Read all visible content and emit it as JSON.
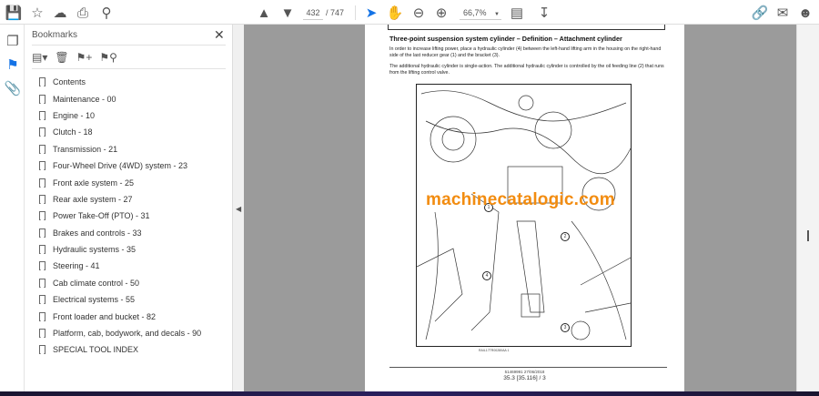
{
  "toolbar": {
    "page_current": "432",
    "page_total": "/ 747",
    "zoom": "66,7%"
  },
  "bookmarks_panel": {
    "title": "Bookmarks",
    "items": [
      "Contents",
      "Maintenance - 00",
      "Engine - 10",
      "Clutch - 18",
      "Transmission - 21",
      "Four-Wheel Drive (4WD) system - 23",
      "Front axle system - 25",
      "Rear axle system - 27",
      "Power Take-Off (PTO) - 31",
      "Brakes and controls - 33",
      "Hydraulic systems - 35",
      "Steering - 41",
      "Cab climate control - 50",
      "Electrical systems - 55",
      "Front loader and bucket - 82",
      "Platform, cab, bodywork, and decals - 90",
      "SPECIAL TOOL INDEX"
    ]
  },
  "document": {
    "heading": "Three-point suspension system cylinder – Definition – Attachment cylinder",
    "para1": "In order to increase lifting power, place a hydraulic cylinder (4) between the left-hand lifting arm in the housing on the right-hand side of the last reducer gear (1) and the bracket (3).",
    "para2": "The additional hydraulic cylinder is single-action. The additional hydraulic cylinder is controlled by the oil feeding line (2) that runs from the lifting control valve.",
    "callouts": [
      "1",
      "2",
      "3",
      "4"
    ],
    "figure_caption": "RAIL17TR00280AA    1",
    "footer_line1": "51469991 27/06/2018",
    "footer_line2": "35.3 [35.116] / 3",
    "watermark": "machinecatalogic.com"
  },
  "colors": {
    "accent": "#1473e6",
    "watermark": "#f28c10"
  }
}
